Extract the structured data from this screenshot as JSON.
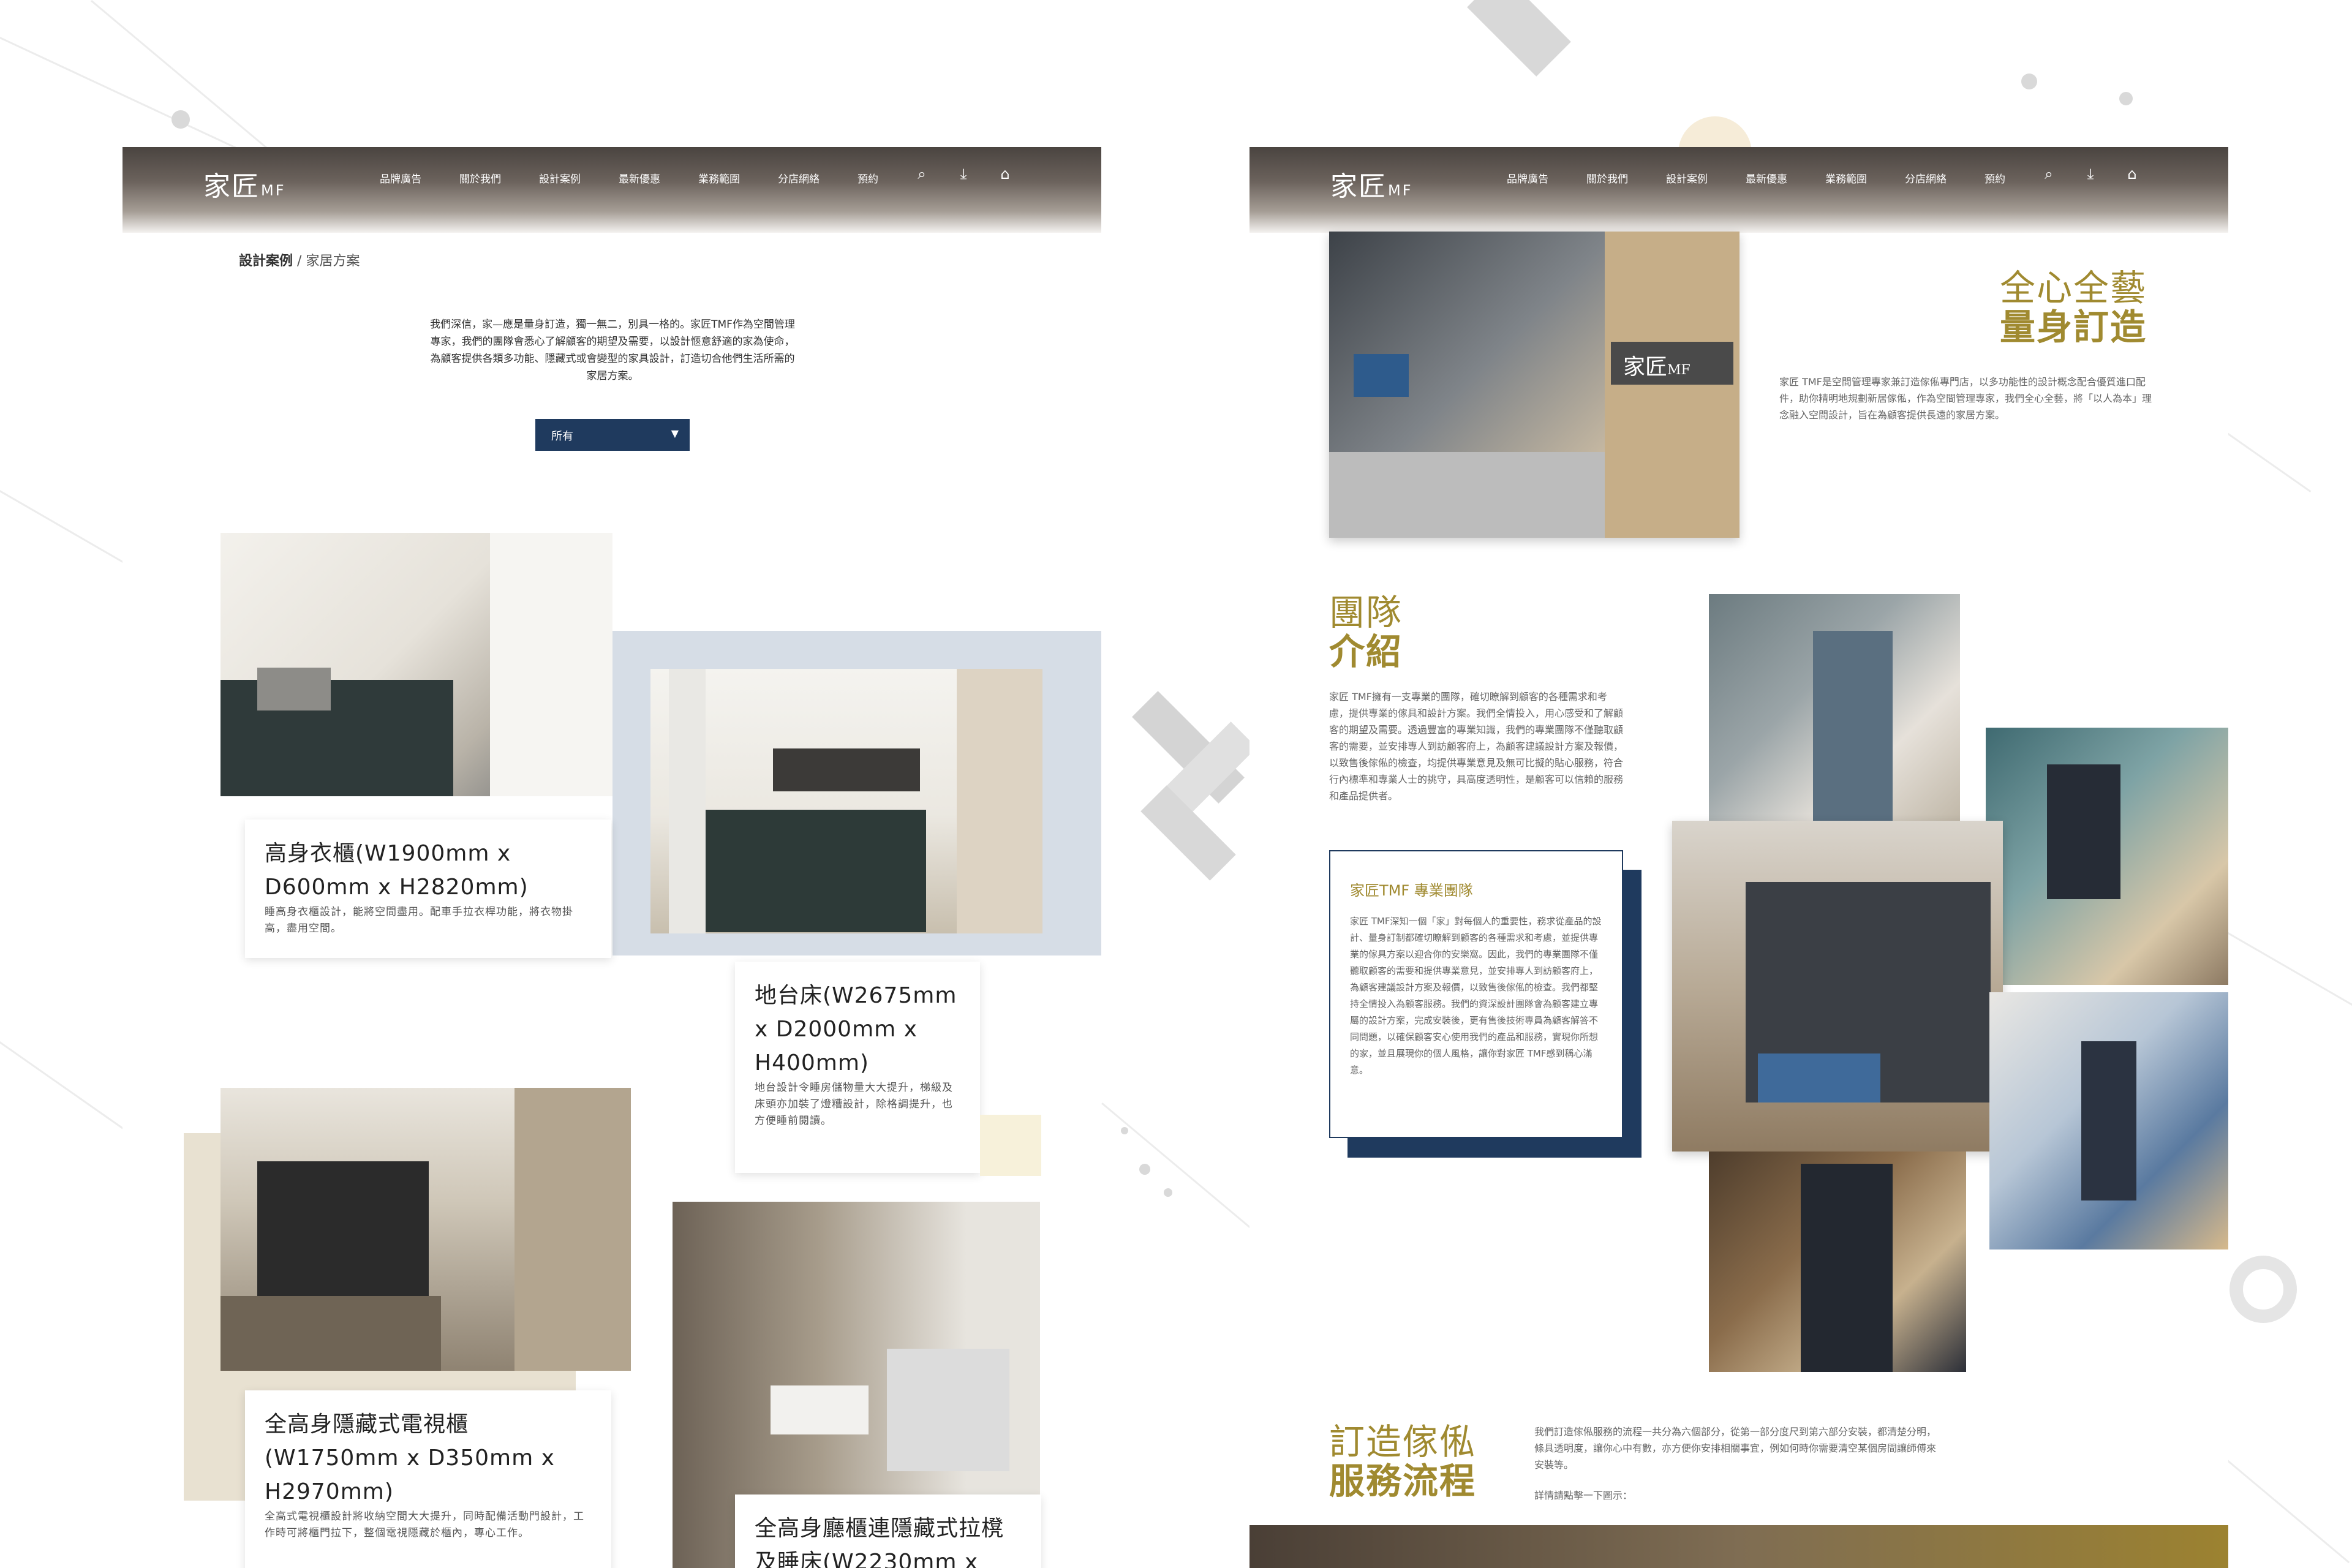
{
  "colors": {
    "navy": "#1f3a5e",
    "gold": "#a08a30",
    "nav_gradient_dark": "#4a4440"
  },
  "nav": {
    "logo_main": "家匠",
    "logo_sub": "MF",
    "links": [
      "品牌廣告",
      "關於我們",
      "設計案例",
      "最新優惠",
      "業務範圍",
      "分店網絡",
      "預約"
    ],
    "icons": [
      "search-icon",
      "download-icon",
      "home-search-icon"
    ]
  },
  "left": {
    "breadcrumb": {
      "current": "設計案例",
      "separator": "/",
      "sub": "家居方案"
    },
    "intro": "我們深信，家—應是量身訂造，獨一無二，別具一格的。家匠TMF作為空間管理專家，我們的團隊會悉心了解顧客的期望及需要，以設計愜意舒適的家為使命，為顧客提供各類多功能、隱藏式或會變型的家具設計，訂造切合他們生活所需的家居方案。",
    "filter": {
      "selected": "所有"
    },
    "cases": [
      {
        "title": "高身衣櫃(W1900mm x D600mm x H2820mm)",
        "desc": "睡高身衣櫃設計，能將空間盡用。配車手拉衣桿功能，將衣物掛高，盡用空間。"
      },
      {
        "title": "地台床(W2675mm x D2000mm x H400mm)",
        "desc": "地台設計令睡房儲物量大大提升，梯級及床頭亦加裝了燈糟設計，除格調提升，也方便睡前閱讀。"
      },
      {
        "title": "全高身隱藏式電視櫃(W1750mm x D350mm x H2970mm)",
        "desc": "全高式電視櫃設計將收納空間大大提升，同時配備活動門設計，工作時可將櫃門拉下，整個電視隱藏於櫃內，專心工作。"
      },
      {
        "title": "全高身廳櫃連隱藏式拉櫈及睡床(W2230mm x",
        "desc": ""
      }
    ]
  },
  "right": {
    "hero_heading": {
      "line1": "全心全藝",
      "line2": "量身訂造"
    },
    "hero_text": "家匠 TMF是空間管理專家兼訂造傢俬專門店，以多功能性的設計概念配合優質進口配件，助你精明地規劃新居傢俬，作為空間管理專家，我們全心全藝，將「以人為本」理念融入空間設計，旨在為顧客提供長遠的家居方案。",
    "team_heading": {
      "line1": "團隊",
      "line2": "介紹"
    },
    "team_text": "家匠 TMF擁有一支專業的團隊，確切瞭解到顧客的各種需求和考慮，提供專業的傢具和設計方案。我們全情投入，用心感受和了解顧客的期望及需要。透過豐富的專業知識，我們的專業團隊不僅聽取顧客的需要，並安排專人到訪顧客府上，為顧客建議設計方案及報價，以致售後傢俬的檢查，均提供專業意見及無可比擬的貼心服務，符合行內標準和專業人士的挑守，具高度透明性，是顧客可以信賴的服務和產品提供者。",
    "team_box": {
      "title": "家匠TMF 專業團隊",
      "text": "家匠 TMF深知一個「家」對每個人的重要性，務求從產品的設計、量身訂制都確切瞭解到顧客的各種需求和考慮，並提供專業的傢具方案以迎合你的安樂窩。因此，我們的專業團隊不僅聽取顧客的需要和提供專業意見，並安排專人到訪顧客府上，為顧客建議設計方案及報價，以致售後傢俬的檢查。我們都堅持全情投入為顧客服務。我們的資深設計團隊會為顧客建立專屬的設計方案，完成安裝後，更有售後技術專員為顧客解答不同問題，以確保顧客安心使用我們的產品和服務，實現你所想的家，並且展現你的個人風格，讓你對家匠 TMF感到稱心滿意。"
    },
    "process_heading": {
      "line1": "訂造傢俬",
      "line2": "服務流程"
    },
    "process_text": "我們訂造傢俬服務的流程一共分為六個部分，從第一部分度尺到第六部分安裝，都清楚分明，條具透明度，讓你心中有數，亦方便你安排相關事宜，例如何時你需要清空某個房間讓師傅來安裝等。",
    "process_more": "詳情請點擊一下圖示："
  }
}
